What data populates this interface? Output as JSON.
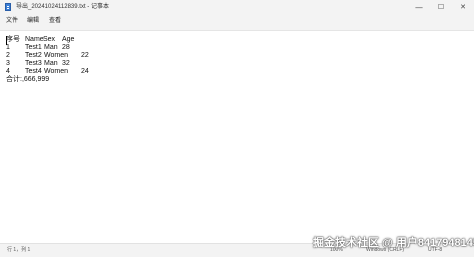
{
  "window": {
    "title": "导出_20241024112839.txt - 记事本",
    "minimize": "—",
    "maximize": "☐",
    "close": "✕"
  },
  "menu": [
    "文件",
    "编辑",
    "查看"
  ],
  "document": {
    "header": [
      "序号",
      "Name",
      "Sex",
      "Age"
    ],
    "rows": [
      [
        "1",
        "Test1",
        "Man",
        "28"
      ],
      [
        "2",
        "Test2",
        "Women",
        "22"
      ],
      [
        "3",
        "Test3",
        "Man",
        "32"
      ],
      [
        "4",
        "Test4",
        "Women",
        "24"
      ]
    ],
    "footer": "合计:,666,999"
  },
  "status": {
    "position": "行 1，列 1",
    "zoom": "100%",
    "line_ending": "Windows (CRLF)",
    "encoding": "UTF-8"
  },
  "watermark": "掘金技术社区 @ 用户8417948145"
}
